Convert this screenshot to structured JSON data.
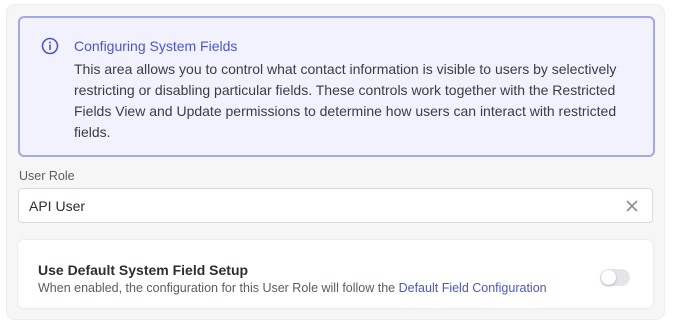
{
  "info": {
    "icon": "info-circle-icon",
    "title": "Configuring System Fields",
    "body": "This area allows you to control what contact information is visible to users by selectively restricting or disabling particular fields. These controls work together with the Restricted Fields View and Update permissions to determine how users can interact with restricted fields."
  },
  "user_role": {
    "label": "User Role",
    "value": "API User",
    "clear_icon": "close-icon"
  },
  "default_setup": {
    "title": "Use Default System Field Setup",
    "description": "When enabled, the configuration for this User Role will follow the ",
    "link_text": "Default Field Configuration",
    "enabled": false
  },
  "colors": {
    "accent": "#4c56c8",
    "info_border": "#a1a9ea",
    "info_background": "#f1f2fd"
  }
}
